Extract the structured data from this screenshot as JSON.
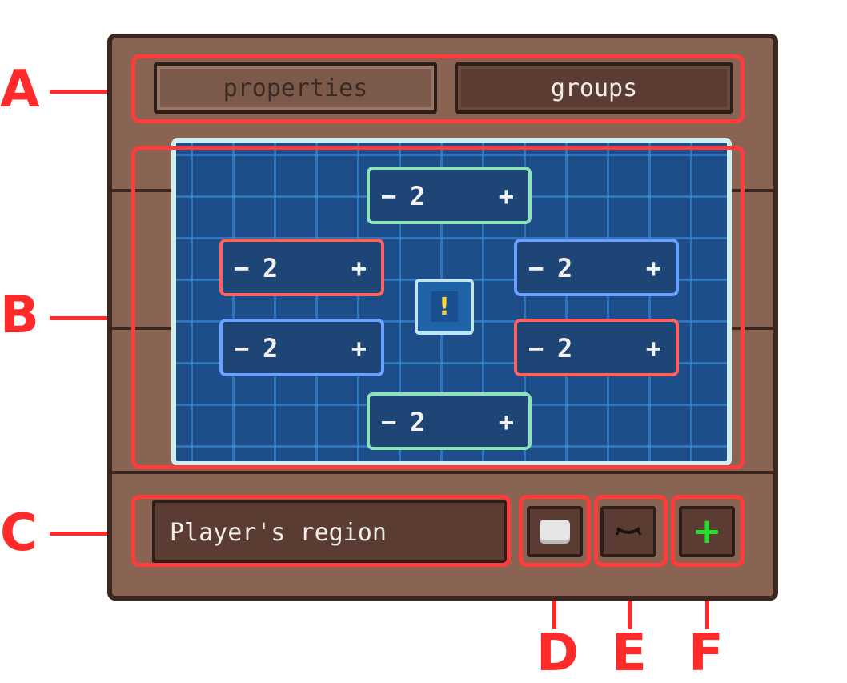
{
  "callouts": {
    "a": "A",
    "b": "B",
    "c": "C",
    "d": "D",
    "e": "E",
    "f": "F"
  },
  "tabs": {
    "properties": "properties",
    "groups": "groups"
  },
  "map": {
    "steppers": {
      "top": {
        "minus": "−",
        "value": "2",
        "plus": "+"
      },
      "upper_left": {
        "minus": "−",
        "value": "2",
        "plus": "+"
      },
      "upper_right": {
        "minus": "−",
        "value": "2",
        "plus": "+"
      },
      "lower_left": {
        "minus": "−",
        "value": "2",
        "plus": "+"
      },
      "lower_right": {
        "minus": "−",
        "value": "2",
        "plus": "+"
      },
      "bottom": {
        "minus": "−",
        "value": "2",
        "plus": "+"
      }
    },
    "marker_icon": "!",
    "colors": {
      "green": "#8be3b6",
      "red": "#ff6060",
      "blue": "#6aa0ff",
      "map_bg": "#1e4e8a"
    }
  },
  "region": {
    "name": "Player's region"
  },
  "buttons": {
    "add_icon": "+",
    "visibility_icon": "closed-eye-icon",
    "color_icon": "color-swatch-icon"
  },
  "theme": {
    "wood": "#8a6452",
    "wood_dark": "#3b2620",
    "callout_red": "#ff2b2b"
  }
}
